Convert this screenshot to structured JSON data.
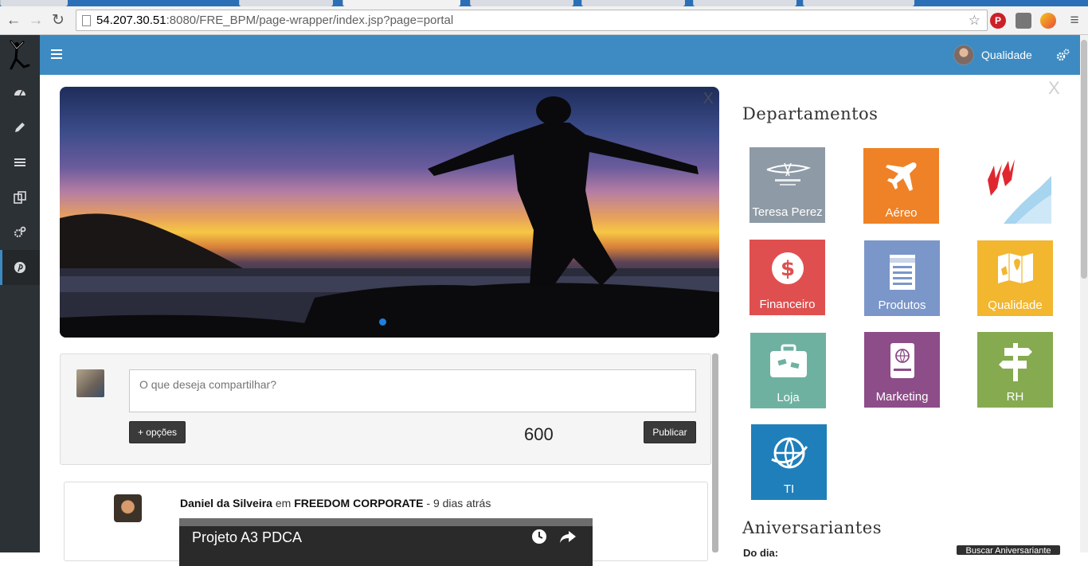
{
  "browser": {
    "url_host": "54.207.30.51",
    "url_rest": ":8080/FRE_BPM/page-wrapper/index.jsp?page=portal"
  },
  "header": {
    "user_name": "Qualidade"
  },
  "sidebar": {
    "items": [
      {
        "icon": "dashboard-icon"
      },
      {
        "icon": "pencil-icon"
      },
      {
        "icon": "list-icon"
      },
      {
        "icon": "documents-icon"
      },
      {
        "icon": "gears-icon"
      },
      {
        "icon": "pinterest-icon",
        "active": true
      }
    ]
  },
  "banner": {
    "close_label": "X"
  },
  "composer": {
    "placeholder": "O que deseja compartilhar?",
    "options_label": "+ opções",
    "char_count": "600",
    "publish_label": "Publicar"
  },
  "post": {
    "author": "Daniel da Silveira",
    "connector": "em",
    "group": "FREEDOM CORPORATE",
    "time": "- 9 dias atrás",
    "video_title": "Projeto A3 PDCA"
  },
  "panel": {
    "close_label": "X",
    "departments_title": "Departamentos",
    "departments": [
      {
        "label": "Teresa Perez",
        "color": "#8e9ba6",
        "icon": "tp-logo-icon"
      },
      {
        "label": "Aéreo",
        "color": "#ef8226",
        "icon": "airplane-icon"
      },
      {
        "label": "",
        "color": "#ffffff",
        "icon": "birds-icon"
      },
      {
        "label": "Financeiro",
        "color": "#e04f4f",
        "icon": "dollar-icon"
      },
      {
        "label": "Produtos",
        "color": "#7b96c9",
        "icon": "hotel-icon"
      },
      {
        "label": "Qualidade",
        "color": "#f2b62f",
        "icon": "map-icon"
      },
      {
        "label": "Loja",
        "color": "#6fb1a0",
        "icon": "suitcase-icon"
      },
      {
        "label": "Marketing",
        "color": "#8d4d88",
        "icon": "passport-icon"
      },
      {
        "label": "RH",
        "color": "#86aa50",
        "icon": "signpost-icon"
      },
      {
        "label": "TI",
        "color": "#1f7fba",
        "icon": "globe-icon"
      }
    ],
    "birthdays_title": "Aniversariantes",
    "birthdays_sub": "Do dia:",
    "birthdays_button": "Buscar Aniversariante"
  }
}
